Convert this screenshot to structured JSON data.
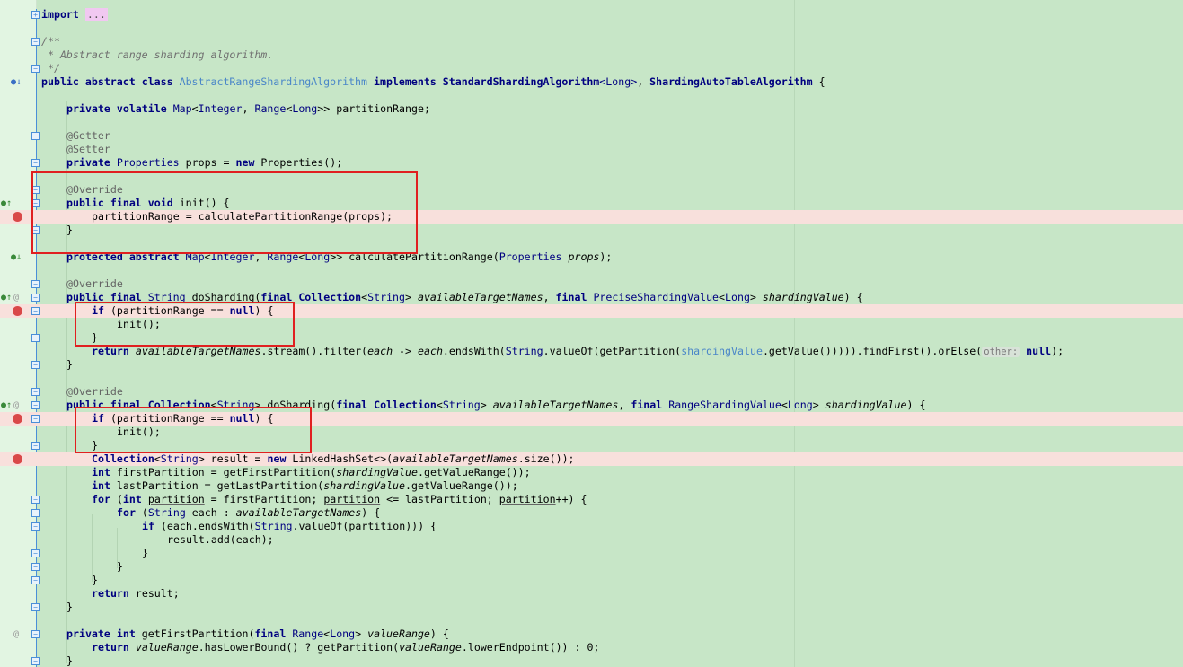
{
  "editor": {
    "collapsed_imports": "...",
    "text": {
      "import": "import",
      "jdoc_open": "/**",
      "jdoc_body": " * Abstract range sharding algorithm.",
      "jdoc_close": " */",
      "public": "public",
      "abstract": "abstract",
      "class": "class",
      "class_name": "AbstractRangeShardingAlgorithm",
      "implements": "implements",
      "std_algo": "StandardShardingAlgorithm",
      "long_gen": "<Long>",
      "comma_space": ", ",
      "auto_algo": "ShardingAutoTableAlgorithm",
      "open_brace": " {",
      "private": "private",
      "volatile": "volatile",
      "map": "Map",
      "lt": "<",
      "integer": "Integer",
      "comma": ", ",
      "range": "Range",
      "long": "Long",
      "gtgt": ">> ",
      "partition_range_field": "partitionRange;",
      "getter": "@Getter",
      "setter": "@Setter",
      "properties": "Properties",
      "props_new": " props = ",
      "new": "new",
      "properties_ctor": " Properties();",
      "override": "@Override",
      "final": "final",
      "void": "void",
      "init_decl": " init() {",
      "assign_call": "partitionRange = calculatePartitionRange(props);",
      "close_brace": "}",
      "protected": "protected",
      "calc_decl_start": "calculatePartitionRange(",
      "props_param": "props",
      "calc_decl_end": ");",
      "string": "String",
      "do_sharding": " doSharding(",
      "collection": "Collection",
      "gt_space": "> ",
      "avail_names": "availableTargetNames",
      "precise_value": "PreciseShardingValue",
      "sharding_value": "shardingValue",
      "close_paren_brace": ") {",
      "if": "if",
      "null_check": " (partitionRange == ",
      "null": "null",
      "init_call": "init();",
      "return": "return",
      "stream_chain_1": ".stream().filter(",
      "each": "each",
      "arrow": " -> ",
      "ends_with": ".endsWith(",
      "value_of": ".valueOf(getPartition(",
      "get_value_tail": ".getValue())))).findFirst().orElse(",
      "other_hint": "other:",
      "end_call": ");",
      "range_value": "RangeShardingValue",
      "result_decl": " result = ",
      "linked_hash_set": " LinkedHashSet<>(",
      "size_tail": ".size());",
      "int": "int",
      "first_decl": " firstPartition = getFirstPartition(",
      "last_decl": " lastPartition = getLastPartition(",
      "get_value_range": ".getValueRange());",
      "for": "for",
      "for_start": " (",
      "partition": "partition",
      "for_mid_1": " = firstPartition; ",
      "for_mid_2": " <= lastPartition; ",
      "for_end": "++) {",
      "each_decl": " each : ",
      "for_each_end": ") {",
      "if_each": " (each.endsWith(",
      "string_value_of": ".valueOf(",
      "if_each_end": "))) {",
      "result_add": "result.add(each);",
      "return_result": " result;",
      "get_first_decl": " getFirstPartition(",
      "value_range": "valueRange",
      "has_lower": ".hasLowerBound() ? getPartition(",
      "lower_endpoint": ".lowerEndpoint()) : 0;",
      "space": " "
    }
  },
  "colors": {
    "background": "#c7e6c7",
    "gutter": "#e2f5e2",
    "breakpoint_line": "#f8e0dc",
    "breakpoint": "#d94848",
    "highlight_box": "#e02020",
    "keyword": "#000080",
    "class_ref": "#4a86c8"
  },
  "icons": {
    "fold": "fold-toggle-icon",
    "breakpoint": "breakpoint-icon",
    "implementing": "implementing-method-icon",
    "override": "override-method-icon",
    "annotation": "at-sign-icon"
  }
}
